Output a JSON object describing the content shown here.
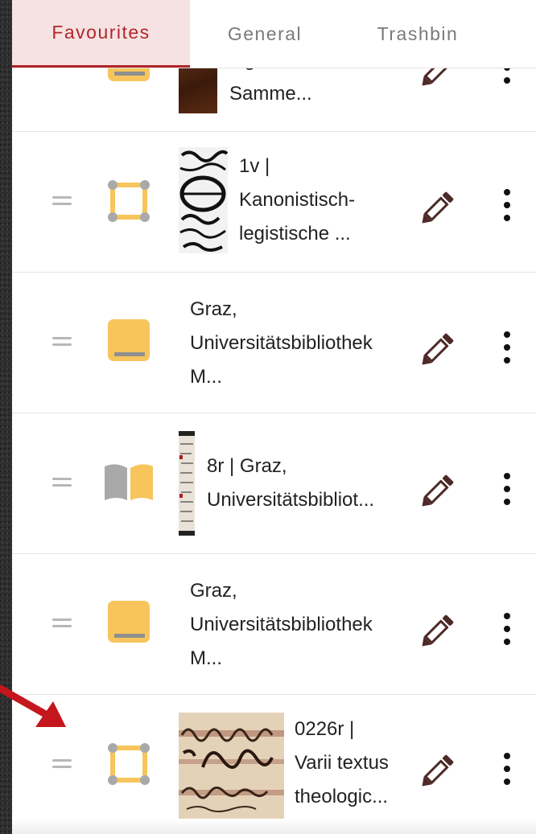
{
  "tabs": [
    {
      "label": "Favourites",
      "active": true
    },
    {
      "label": "General",
      "active": false
    },
    {
      "label": "Trashbin",
      "active": false
    }
  ],
  "items": [
    {
      "type": "book",
      "title": "legistische\nSamme...",
      "thumbnail": "manuscript-brown"
    },
    {
      "type": "region",
      "title": "1v |\nKanonistisch-\nlegistische ...",
      "thumbnail": "manuscript-bw"
    },
    {
      "type": "book",
      "title": "Graz,\nUniversitätsbibliothek\nM...",
      "thumbnail": "none"
    },
    {
      "type": "open-book",
      "title": "8r | Graz,\nUniversitätsbibliot...",
      "thumbnail": "music-notation-strip"
    },
    {
      "type": "book",
      "title": "Graz,\nUniversitätsbibliothek\nM...",
      "thumbnail": "none"
    },
    {
      "type": "region",
      "title": "0226r |\nVarii textus\ntheologic...",
      "thumbnail": "manuscript-script"
    }
  ],
  "colors": {
    "accent": "#b0262b",
    "active_tab_bg": "#f6e2e2",
    "icon_yellow": "#f7c55c",
    "icon_gray": "#a9a9a9",
    "edit_icon": "#4d2a27",
    "annotation_arrow": "#c4161c"
  },
  "icons": {
    "drag": "drag-handle-icon",
    "edit": "pencil-icon",
    "menu": "more-vertical-icon",
    "book": "book-icon",
    "open_book": "open-book-icon",
    "region": "region-selection-icon"
  }
}
